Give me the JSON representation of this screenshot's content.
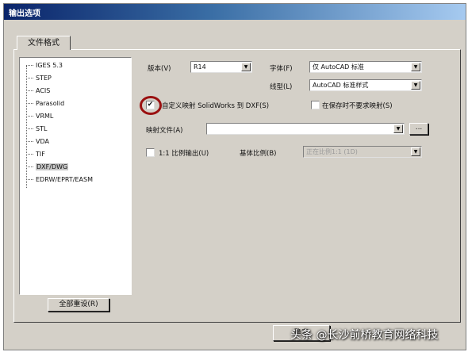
{
  "window": {
    "title": "输出选项"
  },
  "tab": {
    "label": "文件格式"
  },
  "formats": [
    "IGES 5.3",
    "STEP",
    "ACIS",
    "Parasolid",
    "VRML",
    "STL",
    "VDA",
    "TIF",
    "DXF/DWG",
    "EDRW/EPRT/EASM"
  ],
  "selected_format": "DXF/DWG",
  "version": {
    "label": "版本(V)",
    "value": "R14"
  },
  "font": {
    "label": "字体(F)",
    "value": "仅 AutoCAD 标准"
  },
  "linetype": {
    "label": "线型(L)",
    "value": "AutoCAD 标准样式"
  },
  "custom_map": {
    "label": "自定义映射 SolidWorks 到 DXF(S)",
    "checked": true
  },
  "no_ask": {
    "label": "在保存时不要求映射(S)",
    "checked": false
  },
  "map_file": {
    "label": "映射文件(A)",
    "value": "",
    "browse_label": "..."
  },
  "scale_output": {
    "label": "1:1 比例输出(U)",
    "checked": false
  },
  "scale_base": {
    "label": "基体比例(B)",
    "value": "正在比例1:1 (1D)"
  },
  "buttons": {
    "reset_all": "全部重设(R)",
    "ok": "确定"
  },
  "watermark": {
    "text": "头条 @长沙前桥教育网络科技"
  },
  "glyphs": {
    "arrow": "▼",
    "check": "✔"
  },
  "icons": {
    "watermark": "circle-icon"
  }
}
